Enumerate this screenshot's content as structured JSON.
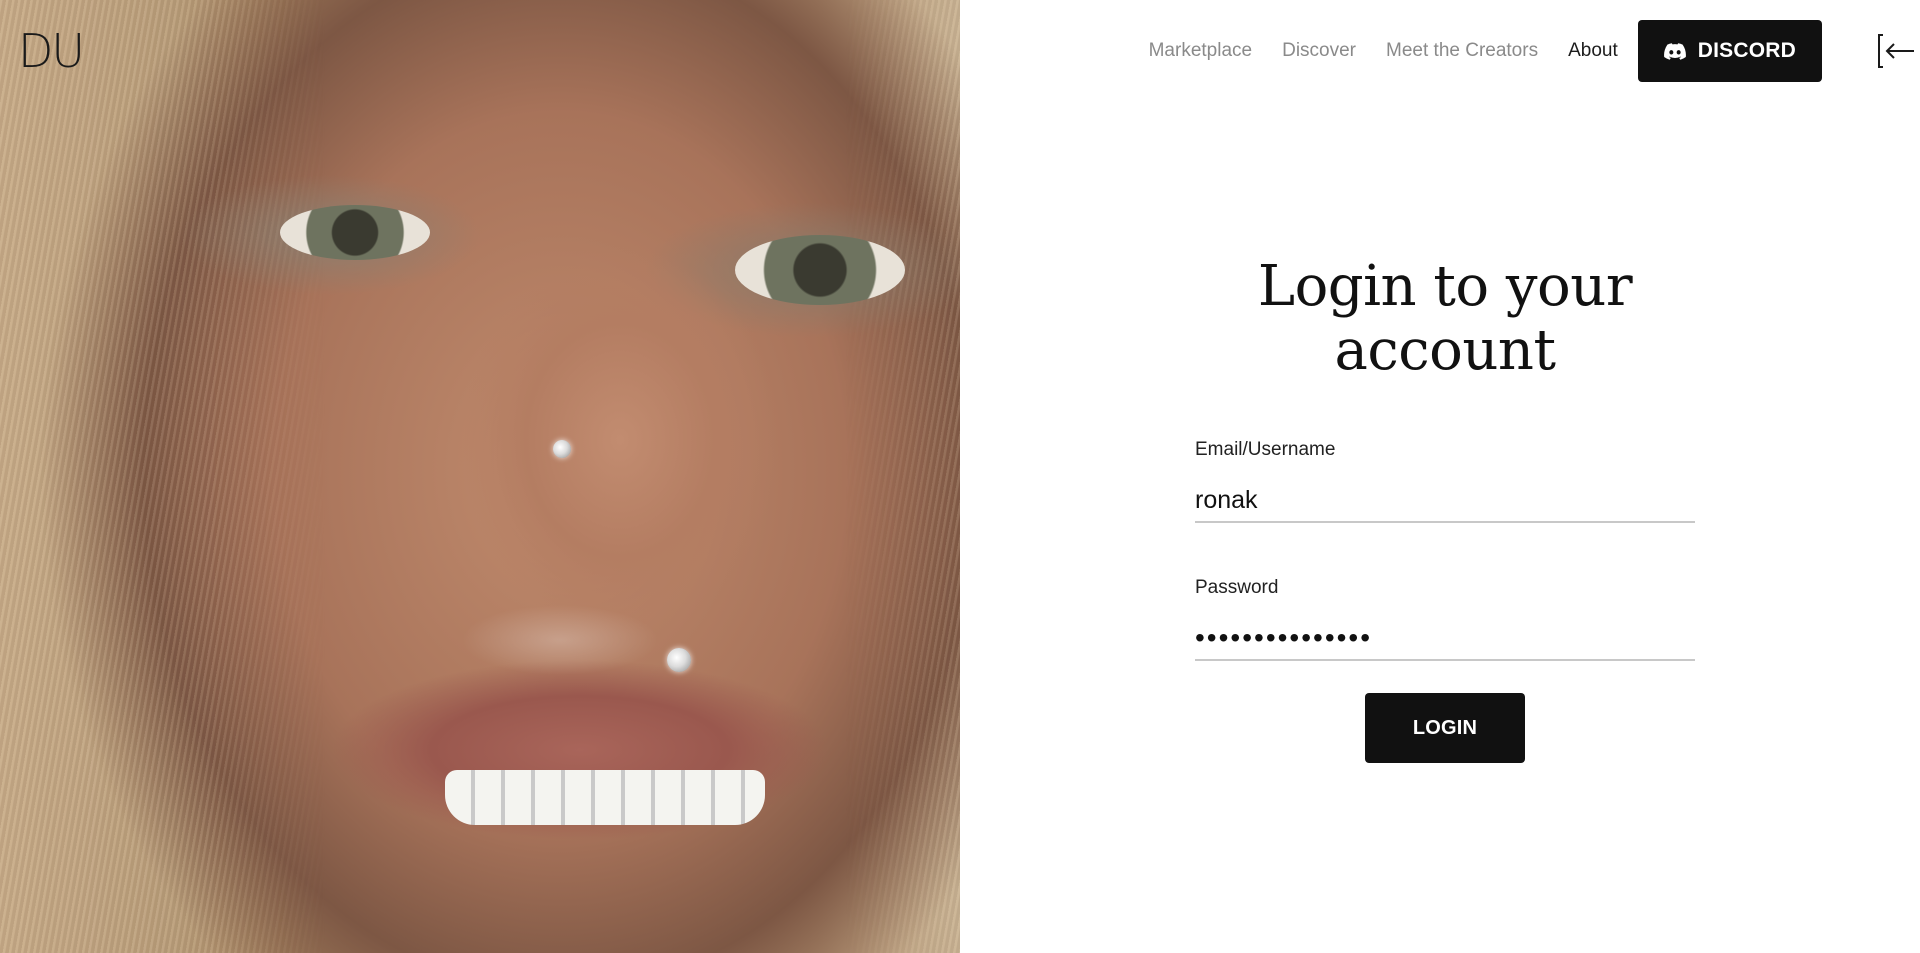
{
  "brand": {
    "logo_text": "DU"
  },
  "nav": {
    "links": [
      {
        "label": "Marketplace"
      },
      {
        "label": "Discover"
      },
      {
        "label": "Meet the Creators"
      },
      {
        "label": "About"
      }
    ],
    "discord_label": "DISCORD",
    "discord_icon": "discord-icon",
    "login_icon": "login-arrow-icon"
  },
  "login": {
    "title_line1": "Login to your",
    "title_line2": "account",
    "email_label": "Email/Username",
    "email_value": "ronak",
    "password_label": "Password",
    "password_value": "•••••••••••••••",
    "submit_label": "LOGIN"
  },
  "colors": {
    "primary": "#111111",
    "nav_muted": "#8a8a8a",
    "underline": "#c8c8c8"
  }
}
